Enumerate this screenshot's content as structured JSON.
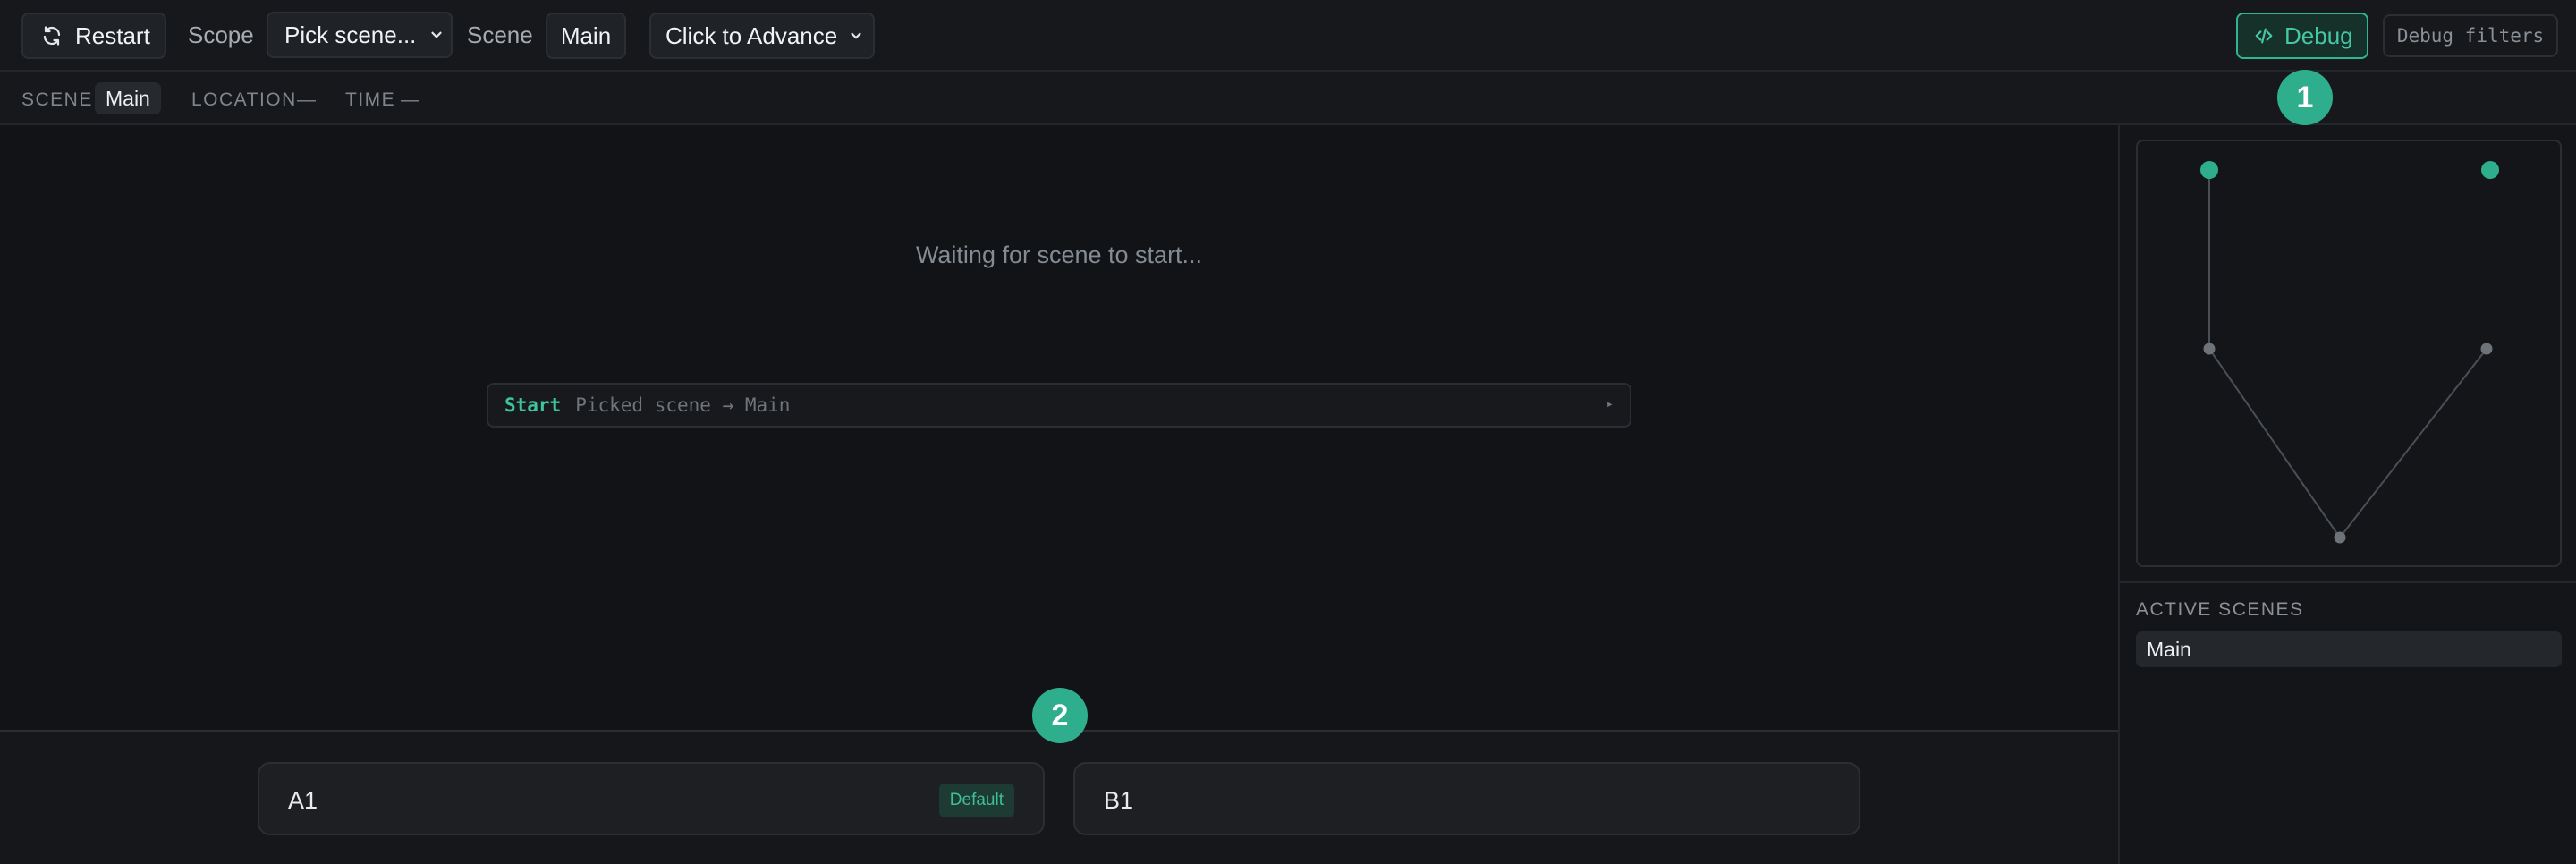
{
  "toolbar": {
    "restart_label": "Restart",
    "scope_label": "Scope",
    "scope_value": "Pick scene...",
    "scene_label": "Scene",
    "scene_value": "Main",
    "advance_value": "Click to Advance",
    "debug_label": "Debug",
    "debug_filters_label": "Debug filters"
  },
  "status": {
    "scene_key": "SCENE",
    "scene_value": "Main",
    "location_key": "LOCATION",
    "location_value": "—",
    "time_key": "TIME",
    "time_value": "—"
  },
  "main": {
    "waiting_text": "Waiting for scene to start...",
    "log": {
      "tag": "Start",
      "message": "Picked scene → Main",
      "caret": "▸"
    }
  },
  "choices": [
    {
      "label": "A1",
      "badge": "Default"
    },
    {
      "label": "B1",
      "badge": ""
    }
  ],
  "markers": [
    "1",
    "2"
  ],
  "side": {
    "active_scenes_title": "ACTIVE SCENES",
    "active_scenes": [
      "Main"
    ]
  },
  "colors": {
    "accent": "#2fae8d",
    "accent_text": "#45c7a4",
    "background": "#111317",
    "panel": "#16181c"
  },
  "icons": {
    "restart": "refresh-icon",
    "dropdown": "chevron-down-icon",
    "debug": "code-icon"
  }
}
